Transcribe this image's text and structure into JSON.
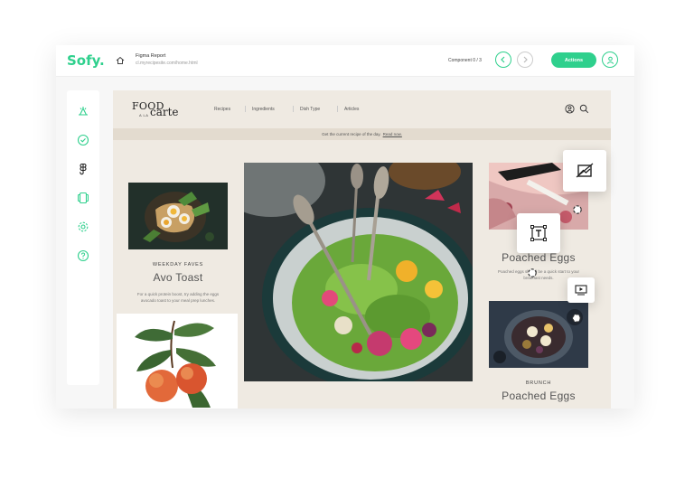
{
  "app": {
    "logo": "Sofy.",
    "report_title": "Figma Report",
    "report_path": "cl.myrecipesite.com/home.html",
    "component_counter": "Component 0 / 3",
    "actions_label": "Actions",
    "accent_color": "#2fd08d"
  },
  "sidebar": {
    "icons": [
      "app-icon",
      "check-circle-icon",
      "figma-icon",
      "devices-icon",
      "settings-icon",
      "help-icon"
    ]
  },
  "site": {
    "brand": {
      "food": "FOOD",
      "ala": "A LA",
      "carte": "carte"
    },
    "menu": [
      "Recipes",
      "Ingredients",
      "Dish Type",
      "Articles"
    ],
    "promo_text": "Get the current recipe of the day.",
    "promo_link": "Read now.",
    "cards": {
      "left": {
        "category": "WEEKDAY FAVES",
        "title": "Avo Toast",
        "description": "For a quick protein boost, try adding the eggs avocado toast to your meal prep lunches."
      },
      "right_top": {
        "title": "Poached Eggs",
        "description": "Poached eggs should be a quick start to your breakfast needs."
      },
      "right_bottom": {
        "category": "BRUNCH",
        "title": "Poached Eggs"
      }
    }
  },
  "floating_tools": [
    "image-compare-icon",
    "text-tool-icon",
    "video-tool-icon"
  ]
}
